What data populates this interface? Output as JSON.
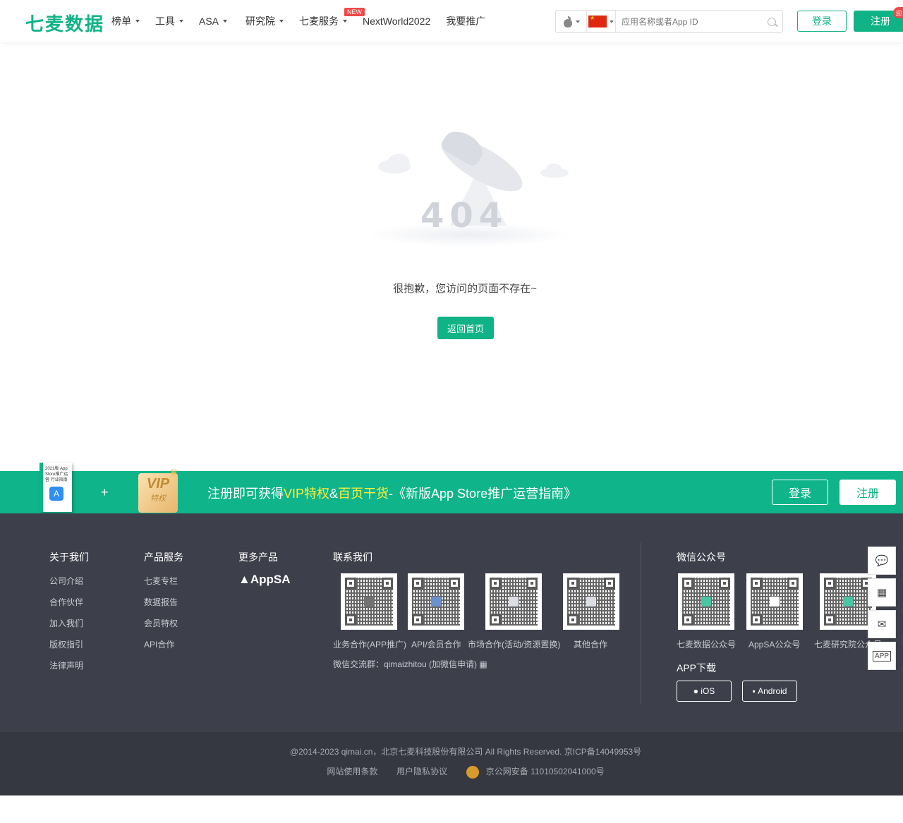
{
  "header": {
    "logo": "七麦数据",
    "nav": [
      {
        "label": "榜单"
      },
      {
        "label": "工具"
      },
      {
        "label": "ASA"
      },
      {
        "label": "研究院"
      },
      {
        "label": "七麦服务",
        "badge": "NEW"
      },
      {
        "label": "NextWorld2022"
      },
      {
        "label": "我要推广"
      }
    ],
    "search_placeholder": "应用名称或者App ID",
    "login": "登录",
    "register": "注册",
    "corner_badge": "迎"
  },
  "error": {
    "code": "404",
    "message": "很抱歉，您访问的页面不存在~",
    "home_button": "返回首页"
  },
  "promo": {
    "book_title": "2021版 App Store推广运营 行业指南",
    "plus": "+",
    "vip": "VIP",
    "vip_sub": "特权",
    "text_prefix": "注册即可获得",
    "text_vip": "VIP特权",
    "text_amp": "&",
    "text_pages": "百页干货",
    "text_suffix": "-《新版App Store推广运营指南》",
    "login": "登录",
    "register": "注册"
  },
  "footer": {
    "about": {
      "title": "关于我们",
      "links": [
        "公司介绍",
        "合作伙伴",
        "加入我们",
        "版权指引",
        "法律声明"
      ]
    },
    "products": {
      "title": "产品服务",
      "links": [
        "七麦专栏",
        "数据报告",
        "会员特权",
        "API合作"
      ]
    },
    "more": {
      "title": "更多产品",
      "appsa": "AppSA"
    },
    "contact": {
      "title": "联系我们",
      "qrs": [
        "业务合作(APP推广)",
        "API/会员合作",
        "市场合作(活动/资源置换)",
        "其他合作"
      ],
      "wechat_group": "微信交流群：qimaizhitou (加微信申请)"
    },
    "wechat": {
      "title": "微信公众号",
      "qrs": [
        "七麦数据公众号",
        "AppSA公众号",
        "七麦研究院公众号"
      ]
    },
    "app_download": {
      "title": "APP下载",
      "ios": "iOS",
      "android": "Android"
    },
    "copyright": "@2014-2023 qimai.cn，北京七麦科技股份有限公司 All Rights Reserved. 京ICP备14049953号",
    "terms": "网站使用条款",
    "privacy": "用户隐私协议",
    "police": "京公网安备 11010502041000号"
  },
  "colors": {
    "brand": "#10b386",
    "footer_bg": "#3d3f4a",
    "highlight": "#ffee3c"
  }
}
